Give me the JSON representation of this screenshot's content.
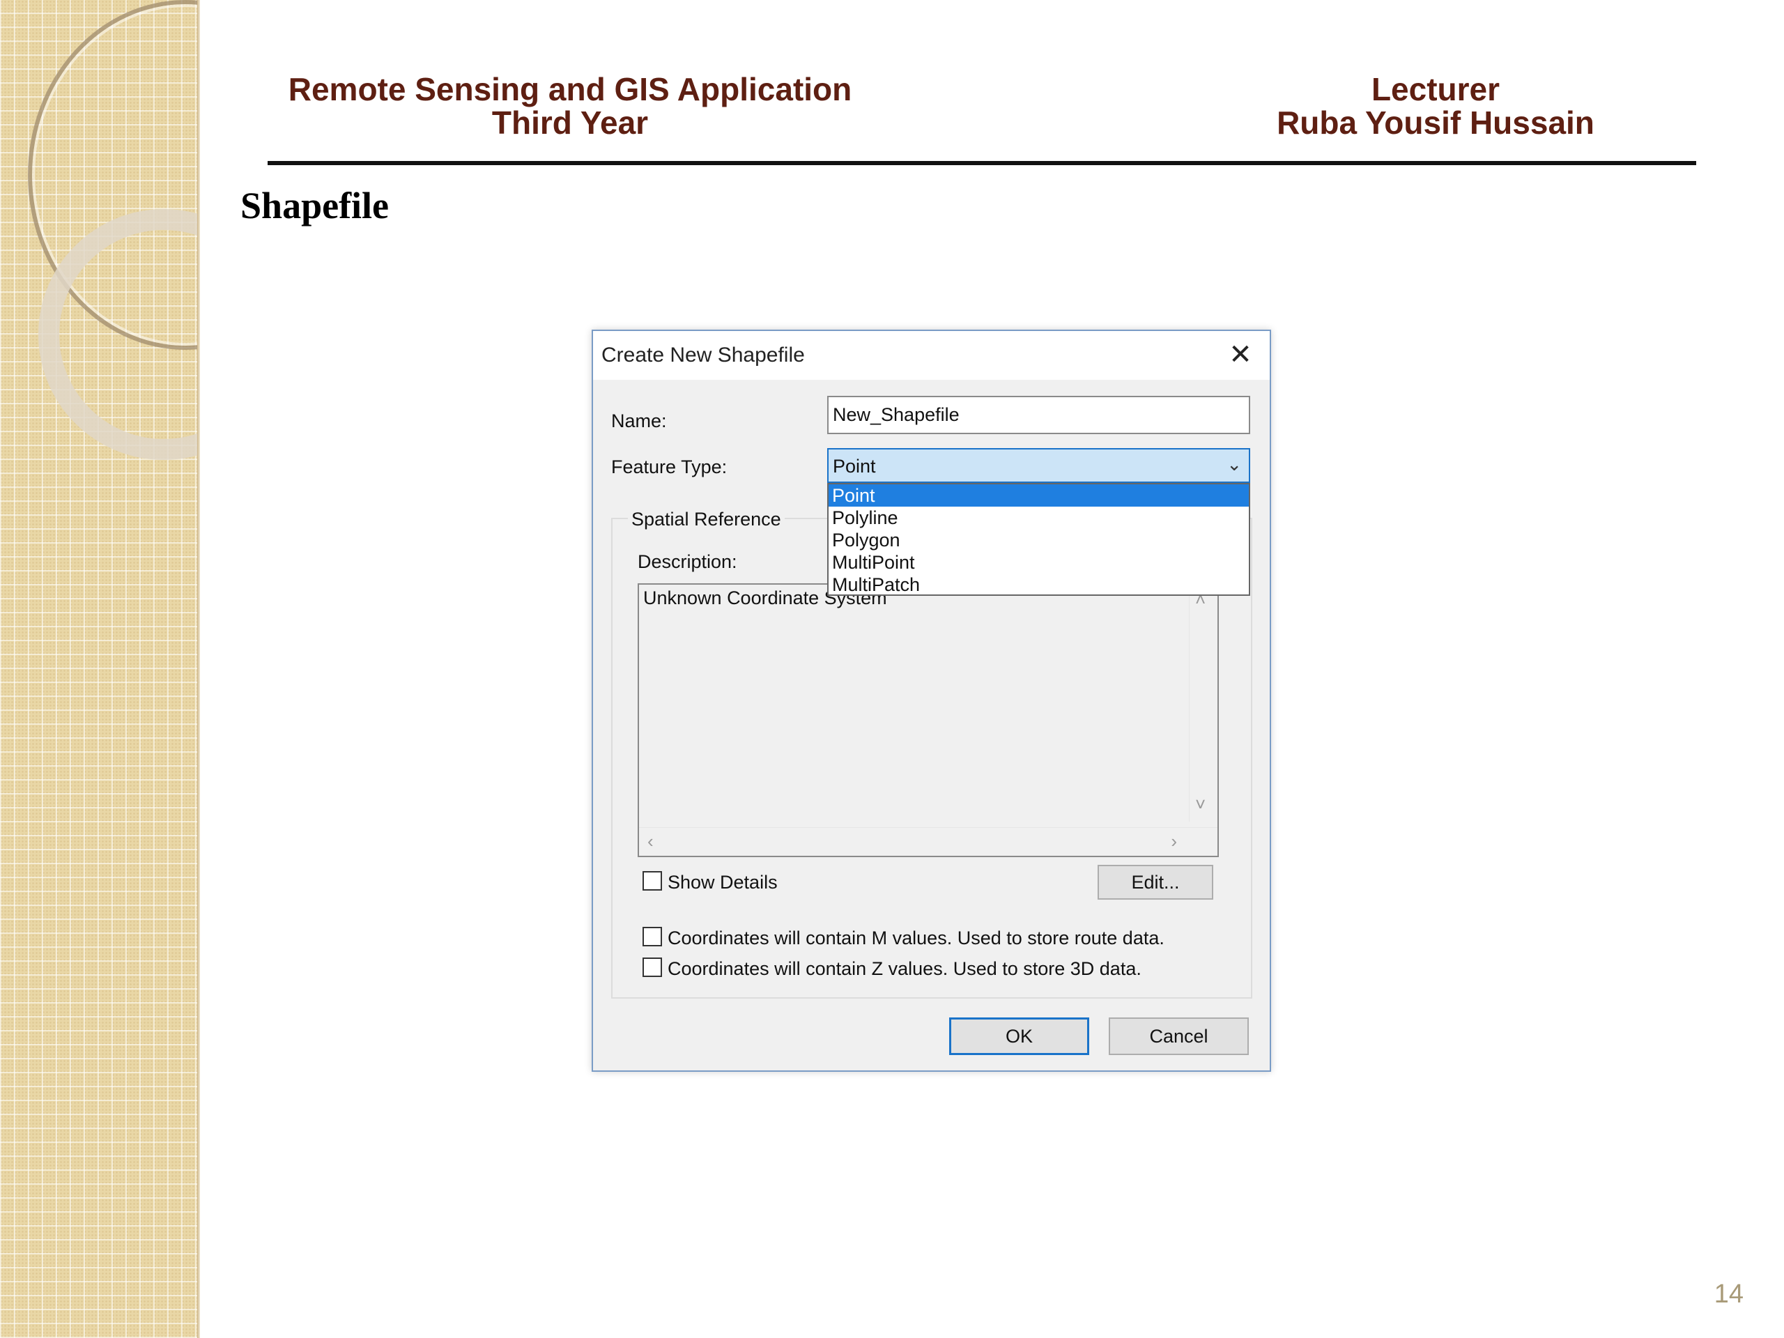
{
  "header": {
    "left_line1": "Remote Sensing and GIS Application",
    "left_line2": "Third Year",
    "right_line1": "Lecturer",
    "right_line2": "Ruba Yousif Hussain"
  },
  "slide": {
    "title": "Shapefile",
    "page_number": "14"
  },
  "dialog": {
    "title": "Create New Shapefile",
    "close_icon": "✕",
    "name_label": "Name:",
    "name_value": "New_Shapefile",
    "feature_type_label": "Feature Type:",
    "feature_type_value": "Point",
    "feature_type_options": [
      "Point",
      "Polyline",
      "Polygon",
      "MultiPoint",
      "MultiPatch"
    ],
    "spatial_reference_label": "Spatial Reference",
    "description_label": "Description:",
    "description_text": "Unknown Coordinate System",
    "show_details_label": "Show Details",
    "edit_button": "Edit...",
    "m_values_label": "Coordinates will contain M values. Used to store route data.",
    "z_values_label": "Coordinates will contain Z values. Used to store 3D data.",
    "ok_button": "OK",
    "cancel_button": "Cancel"
  },
  "colors": {
    "header_text": "#5e1f12",
    "selection": "#1f7fe0",
    "focus_border": "#1a73c9"
  }
}
